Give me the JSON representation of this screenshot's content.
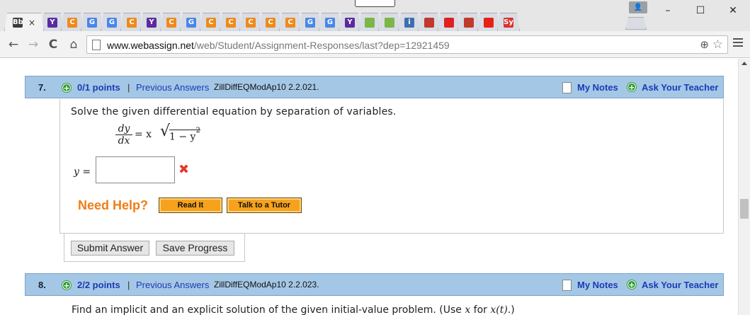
{
  "browser": {
    "tabs": [
      {
        "label": "Bb",
        "color": "#3b3b3b"
      },
      {
        "label": "Y",
        "color": "#5b2aa0"
      },
      {
        "label": "C",
        "color": "#ef8a1b"
      },
      {
        "label": "G",
        "color": "#4a86e8"
      },
      {
        "label": "G",
        "color": "#4a86e8"
      },
      {
        "label": "C",
        "color": "#ef8a1b"
      },
      {
        "label": "Y",
        "color": "#5b2aa0"
      },
      {
        "label": "C",
        "color": "#ef8a1b"
      },
      {
        "label": "G",
        "color": "#4a86e8"
      },
      {
        "label": "C",
        "color": "#ef8a1b"
      },
      {
        "label": "C",
        "color": "#ef8a1b"
      },
      {
        "label": "C",
        "color": "#ef8a1b"
      },
      {
        "label": "C",
        "color": "#ef8a1b"
      },
      {
        "label": "C",
        "color": "#ef8a1b"
      },
      {
        "label": "G",
        "color": "#4a86e8"
      },
      {
        "label": "G",
        "color": "#4a86e8"
      },
      {
        "label": "Y",
        "color": "#5b2aa0"
      },
      {
        "label": "",
        "color": "#7ab648"
      },
      {
        "label": "",
        "color": "#7ab648"
      },
      {
        "label": "i",
        "color": "#3f6db3"
      },
      {
        "label": "",
        "color": "#c0392b"
      },
      {
        "label": "",
        "color": "#e02020"
      },
      {
        "label": "",
        "color": "#c0392b"
      },
      {
        "label": "",
        "color": "#e62117"
      },
      {
        "label": "Sy",
        "color": "#d9312b"
      }
    ],
    "active_tab_close": "×",
    "url_scheme_host": "www.webassign.net",
    "url_path": "/web/Student/Assignment-Responses/last?dep=12921459",
    "back_icon": "←",
    "forward_icon": "→",
    "reload_icon": "C",
    "home_icon": "⌂",
    "zoom_icon": "⊕",
    "star_icon": "☆",
    "minimize": "–",
    "maximize": "☐",
    "close": "✕"
  },
  "question7": {
    "number": "7.",
    "points": "0/1 points",
    "separator": "|",
    "previous_answers": "Previous Answers",
    "code": "ZillDiffEQModAp10 2.2.021.",
    "my_notes": "My Notes",
    "ask_teacher": "Ask Your Teacher",
    "prompt": "Solve the given differential equation by separation of variables.",
    "eq_num": "dy",
    "eq_den": "dx",
    "eq_rhs": "= x",
    "eq_radicand": "1 − y",
    "eq_exp": "2",
    "answer_label": "y",
    "answer_eq": " =",
    "answer_value": "",
    "wrong_mark": "✖",
    "need_help": "Need Help?",
    "read_it": "Read It",
    "talk_tutor": "Talk to a Tutor",
    "submit": "Submit Answer",
    "save": "Save Progress"
  },
  "question8": {
    "number": "8.",
    "points": "2/2 points",
    "separator": "|",
    "previous_answers": "Previous Answers",
    "code": "ZillDiffEQModAp10 2.2.023.",
    "my_notes": "My Notes",
    "ask_teacher": "Ask Your Teacher",
    "prompt_start": "Find an implicit and an explicit solution of the given initial-value problem. (Use ",
    "prompt_var": "x",
    "prompt_mid": " for ",
    "prompt_func": "x(t)",
    "prompt_end": ".)"
  },
  "colors": {
    "header_bg": "#a5c7e6",
    "link": "#1a3bb5",
    "need_help": "#ef7d17",
    "help_button": "#f6a21c",
    "wrong": "#e33b2f"
  }
}
